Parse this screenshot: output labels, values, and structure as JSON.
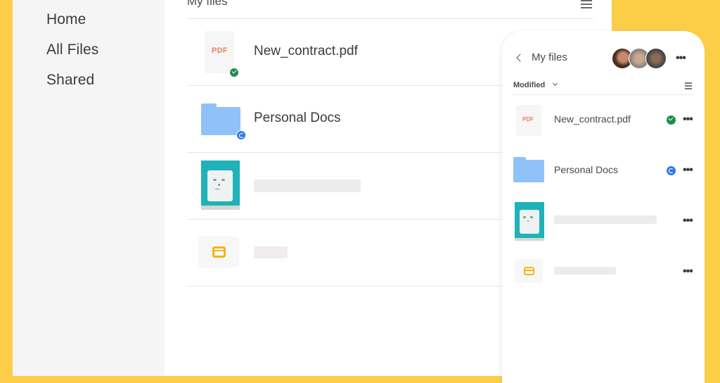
{
  "sidebar": {
    "items": [
      {
        "label": "Home"
      },
      {
        "label": "All Files"
      },
      {
        "label": "Shared"
      }
    ]
  },
  "main": {
    "title": "My files",
    "menu_icon": "hamburger-icon",
    "files": [
      {
        "name": "New_contract.pdf",
        "type": "pdf",
        "thumb_label": "PDF",
        "status": "synced"
      },
      {
        "name": "Personal Docs",
        "type": "folder",
        "status": "syncing"
      },
      {
        "name": "",
        "type": "image",
        "status": ""
      },
      {
        "name": "",
        "type": "slides",
        "status": ""
      }
    ]
  },
  "mobile": {
    "back_icon": "chevron-left-icon",
    "title": "My files",
    "avatars": [
      "avatar-1",
      "avatar-2",
      "avatar-3"
    ],
    "more_label": "•••",
    "sort_label": "Modified",
    "files": [
      {
        "name": "New_contract.pdf",
        "thumb_label": "PDF",
        "status": "synced",
        "more_label": "•••"
      },
      {
        "name": "Personal Docs",
        "status": "syncing",
        "more_label": "•••"
      },
      {
        "name": "",
        "status": "",
        "more_label": "•••"
      },
      {
        "name": "",
        "status": "",
        "more_label": "•••"
      }
    ]
  },
  "colors": {
    "background": "#fcce48",
    "sidebar": "#f5f5f5",
    "synced": "#1e8d4f",
    "syncing": "#2f7ae5",
    "folder": "#90c2fa",
    "pdf_label": "#f07f5e",
    "slides": "#f4b614"
  }
}
